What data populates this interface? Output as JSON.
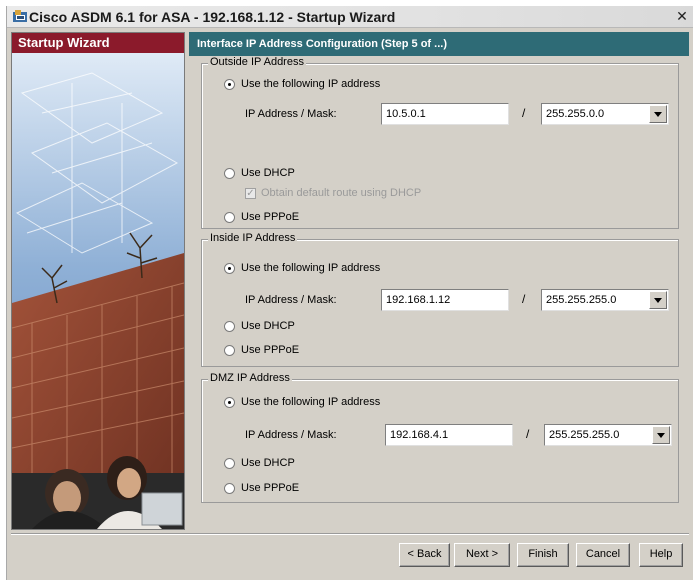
{
  "window": {
    "title": "Cisco ASDM 6.1 for ASA - 192.168.1.12 - Startup Wizard",
    "close_glyph": "✕"
  },
  "left_panel": {
    "header": "Startup Wizard"
  },
  "main": {
    "header": "Interface IP Address Configuration    (Step 5 of ...)"
  },
  "outside": {
    "group_label": "Outside IP Address",
    "use_following": "Use the following IP address",
    "mask_label": "IP Address / Mask:",
    "ip_value": "10.5.0.1",
    "slash": "/",
    "mask_value": "255.255.0.0",
    "use_dhcp": "Use DHCP",
    "obtain_default_route": "Obtain default route using DHCP",
    "use_pppoe": "Use PPPoE"
  },
  "inside": {
    "group_label": "Inside IP Address",
    "use_following": "Use the following IP address",
    "mask_label": "IP Address / Mask:",
    "ip_value": "192.168.1.12",
    "slash": "/",
    "mask_value": "255.255.255.0",
    "use_dhcp": "Use DHCP",
    "use_pppoe": "Use PPPoE"
  },
  "dmz": {
    "group_label": "DMZ IP Address",
    "use_following": "Use the following IP address",
    "mask_label": "IP Address / Mask:",
    "ip_value": "192.168.4.1",
    "slash": "/",
    "mask_value": "255.255.255.0",
    "use_dhcp": "Use DHCP",
    "use_pppoe": "Use PPPoE"
  },
  "buttons": {
    "back": "< Back",
    "next": "Next >",
    "finish": "Finish",
    "cancel": "Cancel",
    "help": "Help"
  },
  "colors": {
    "left_header_bg": "#8b1a2b",
    "main_header_bg": "#2e6b76",
    "dialog_bg": "#d4d0c8"
  },
  "icons": {
    "title": "cisco-asdm-app-icon",
    "close": "close-icon"
  }
}
